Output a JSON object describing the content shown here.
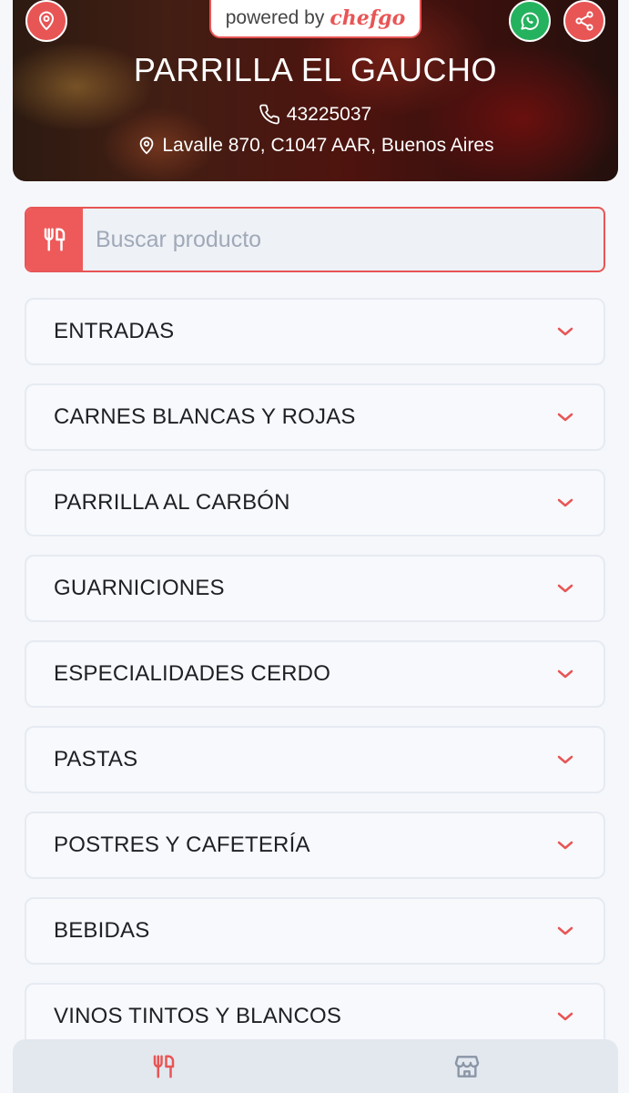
{
  "header": {
    "powered_by": "powered by",
    "brand": "chefgo",
    "restaurant_name": "PARRILLA EL GAUCHO",
    "phone": "43225037",
    "address": "Lavalle 870, C1047 AAR, Buenos Aires",
    "icons": {
      "location": "map-pin-icon",
      "whatsapp": "whatsapp-icon",
      "share": "share-icon"
    }
  },
  "search": {
    "placeholder": "Buscar producto",
    "icon": "utensils-icon"
  },
  "categories": [
    {
      "label": "ENTRADAS"
    },
    {
      "label": "CARNES BLANCAS Y ROJAS"
    },
    {
      "label": "PARRILLA AL CARBÓN"
    },
    {
      "label": "GUARNICIONES"
    },
    {
      "label": "ESPECIALIDADES CERDO"
    },
    {
      "label": "PASTAS"
    },
    {
      "label": "POSTRES Y CAFETERÍA"
    },
    {
      "label": "BEBIDAS"
    },
    {
      "label": "VINOS TINTOS Y BLANCOS"
    }
  ],
  "bottom_nav": {
    "items": [
      {
        "icon": "utensils-icon",
        "active": true
      },
      {
        "icon": "store-icon",
        "active": false
      }
    ]
  },
  "colors": {
    "accent": "#e85555",
    "whatsapp": "#25b25e",
    "background": "#f5f7fa",
    "card_border": "#e6ebf2",
    "nav_bg": "#e3e8ef",
    "inactive_icon": "#8a95a6"
  }
}
